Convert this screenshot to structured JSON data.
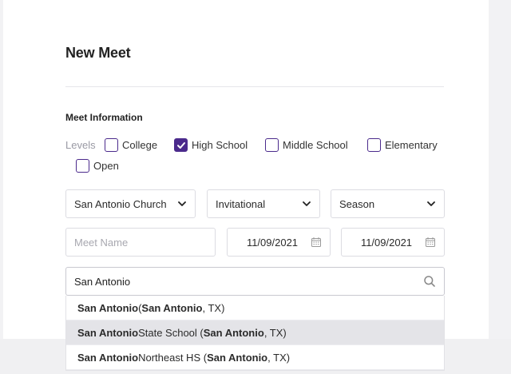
{
  "form": {
    "title": "New Meet",
    "section_label": "Meet Information",
    "levels_label": "Levels",
    "levels": [
      {
        "label": "College",
        "checked": false
      },
      {
        "label": "High School",
        "checked": true
      },
      {
        "label": "Middle School",
        "checked": false
      },
      {
        "label": "Elementary",
        "checked": false
      },
      {
        "label": "Open",
        "checked": false
      }
    ],
    "selects": {
      "location": "San Antonio Church",
      "meet_type": "Invitational",
      "season": "Season"
    },
    "meet_name": {
      "value": "",
      "placeholder": "Meet Name"
    },
    "start_date": "11/09/2021",
    "end_date": "11/09/2021",
    "search": {
      "value": "San Antonio"
    }
  },
  "suggestions": [
    {
      "pre": "San Antonio",
      "mid": " (",
      "bold2": "San Antonio",
      "post": ", TX)",
      "active": false
    },
    {
      "pre": "San Antonio",
      "mid": " State School (",
      "bold2": "San Antonio",
      "post": ", TX)",
      "active": true
    },
    {
      "pre": "San Antonio",
      "mid": " Northeast HS (",
      "bold2": "San Antonio",
      "post": ", TX)",
      "active": false
    }
  ],
  "colors": {
    "accent": "#4b2a8c",
    "highlight": "#e4e4e8"
  },
  "icons": {
    "select": "chevron-down-icon",
    "date": "calendar-icon",
    "search": "search-icon",
    "checkbox": "checkmark-icon"
  }
}
